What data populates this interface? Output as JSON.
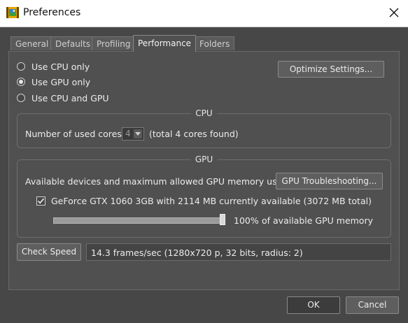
{
  "window": {
    "title": "Preferences",
    "app_icon": "filmstrip-app-icon",
    "close_icon": "close-icon"
  },
  "tabs": [
    {
      "label": "General",
      "active": false
    },
    {
      "label": "Defaults",
      "active": false
    },
    {
      "label": "Profiling",
      "active": false
    },
    {
      "label": "Performance",
      "active": true
    },
    {
      "label": "Folders",
      "active": false
    }
  ],
  "processing_mode": {
    "options": [
      "Use CPU only",
      "Use GPU only",
      "Use CPU and GPU"
    ],
    "selected": "Use GPU only"
  },
  "optimize_button": "Optimize Settings...",
  "cpu_group": {
    "title": "CPU",
    "cores_label": "Number of used cores:",
    "cores_value": "4",
    "cores_found": "(total 4 cores found)"
  },
  "gpu_group": {
    "title": "GPU",
    "devices_label": "Available devices and maximum allowed GPU memory usage:",
    "troubleshoot_button": "GPU Troubleshooting...",
    "device_label": "GeForce GTX 1060 3GB with 2114 MB currently available (3072 MB total)",
    "device_checked": true,
    "memory_percent_value": 100,
    "memory_percent": "100%",
    "memory_suffix": "of available GPU memory"
  },
  "speed": {
    "button": "Check Speed",
    "result": "14.3 frames/sec (1280x720 p, 32 bits, radius: 2)"
  },
  "footer": {
    "ok": "OK",
    "cancel": "Cancel"
  }
}
